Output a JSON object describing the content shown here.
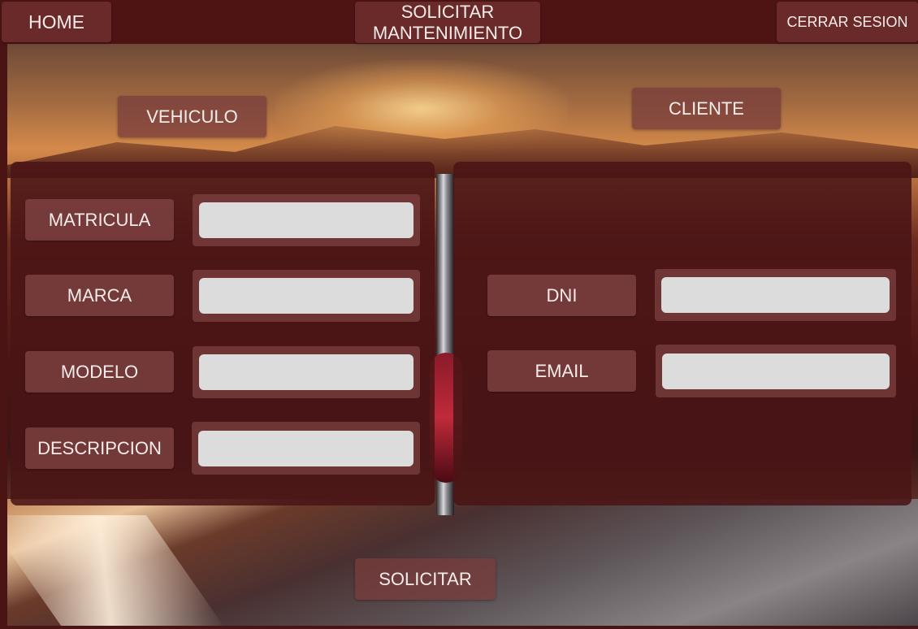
{
  "nav": {
    "home_label": "HOME",
    "request_label": "SOLICITAR\nMANTENIMIENTO",
    "logout_label": "CERRAR SESION"
  },
  "vehicle": {
    "heading": "VEHICULO",
    "fields": [
      {
        "label": "MATRICULA",
        "value": "",
        "placeholder": ""
      },
      {
        "label": "MARCA",
        "value": "",
        "placeholder": ""
      },
      {
        "label": "MODELO",
        "value": "",
        "placeholder": ""
      },
      {
        "label": "DESCRIPCION",
        "value": "",
        "placeholder": ""
      }
    ]
  },
  "client": {
    "heading": "CLIENTE",
    "fields": [
      {
        "label": "DNI",
        "value": "",
        "placeholder": ""
      },
      {
        "label": "EMAIL",
        "value": "",
        "placeholder": ""
      }
    ]
  },
  "submit_label": "SOLICITAR",
  "colors": {
    "topbar": "#4e1414",
    "panel": "#4a1416",
    "button": "#7a3c3c",
    "input": "#dcdcdc"
  }
}
